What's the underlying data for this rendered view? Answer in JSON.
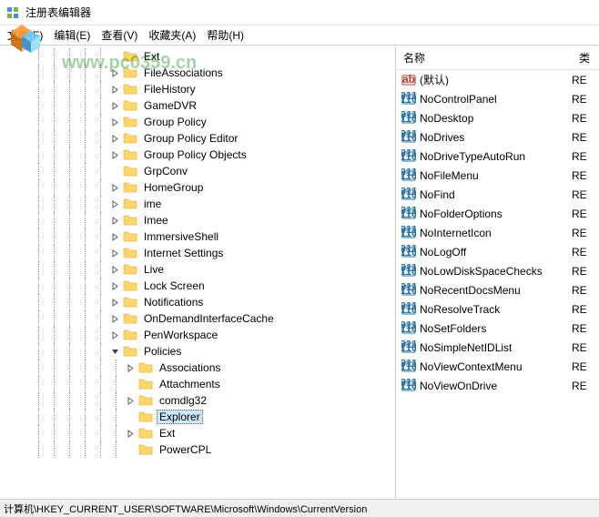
{
  "window": {
    "title": "注册表编辑器"
  },
  "menu": {
    "file": "文件(F)",
    "edit": "编辑(E)",
    "view": "查看(V)",
    "fav": "收藏夹(A)",
    "help": "帮助(H)"
  },
  "watermark": "www.pc0359.cn",
  "list_header": {
    "name": "名称",
    "type": "类"
  },
  "tree": [
    {
      "depth": 7,
      "exp": "",
      "label": "Ext"
    },
    {
      "depth": 7,
      "exp": ">",
      "label": "FileAssociations"
    },
    {
      "depth": 7,
      "exp": ">",
      "label": "FileHistory"
    },
    {
      "depth": 7,
      "exp": ">",
      "label": "GameDVR"
    },
    {
      "depth": 7,
      "exp": ">",
      "label": "Group Policy"
    },
    {
      "depth": 7,
      "exp": ">",
      "label": "Group Policy Editor"
    },
    {
      "depth": 7,
      "exp": ">",
      "label": "Group Policy Objects"
    },
    {
      "depth": 7,
      "exp": "",
      "label": "GrpConv"
    },
    {
      "depth": 7,
      "exp": ">",
      "label": "HomeGroup"
    },
    {
      "depth": 7,
      "exp": ">",
      "label": "ime"
    },
    {
      "depth": 7,
      "exp": ">",
      "label": "Imee"
    },
    {
      "depth": 7,
      "exp": ">",
      "label": "ImmersiveShell"
    },
    {
      "depth": 7,
      "exp": ">",
      "label": "Internet Settings"
    },
    {
      "depth": 7,
      "exp": ">",
      "label": "Live"
    },
    {
      "depth": 7,
      "exp": ">",
      "label": "Lock Screen"
    },
    {
      "depth": 7,
      "exp": ">",
      "label": "Notifications"
    },
    {
      "depth": 7,
      "exp": ">",
      "label": "OnDemandInterfaceCache"
    },
    {
      "depth": 7,
      "exp": ">",
      "label": "PenWorkspace"
    },
    {
      "depth": 7,
      "exp": "v",
      "label": "Policies"
    },
    {
      "depth": 8,
      "exp": ">",
      "label": "Associations"
    },
    {
      "depth": 8,
      "exp": "",
      "label": "Attachments"
    },
    {
      "depth": 8,
      "exp": ">",
      "label": "comdlg32"
    },
    {
      "depth": 8,
      "exp": "",
      "label": "Explorer",
      "selected": true
    },
    {
      "depth": 8,
      "exp": ">",
      "label": "Ext"
    },
    {
      "depth": 8,
      "exp": "",
      "label": "PowerCPL"
    }
  ],
  "values": [
    {
      "icon": "ab",
      "name": "(默认)",
      "type": "RE"
    },
    {
      "icon": "110",
      "name": "NoControlPanel",
      "type": "RE"
    },
    {
      "icon": "110",
      "name": "NoDesktop",
      "type": "RE"
    },
    {
      "icon": "110",
      "name": "NoDrives",
      "type": "RE"
    },
    {
      "icon": "110",
      "name": "NoDriveTypeAutoRun",
      "type": "RE"
    },
    {
      "icon": "110",
      "name": "NoFileMenu",
      "type": "RE"
    },
    {
      "icon": "110",
      "name": "NoFind",
      "type": "RE"
    },
    {
      "icon": "110",
      "name": "NoFolderOptions",
      "type": "RE"
    },
    {
      "icon": "110",
      "name": "NoInternetIcon",
      "type": "RE"
    },
    {
      "icon": "110",
      "name": "NoLogOff",
      "type": "RE"
    },
    {
      "icon": "110",
      "name": "NoLowDiskSpaceChecks",
      "type": "RE"
    },
    {
      "icon": "110",
      "name": "NoRecentDocsMenu",
      "type": "RE"
    },
    {
      "icon": "110",
      "name": "NoResolveTrack",
      "type": "RE"
    },
    {
      "icon": "110",
      "name": "NoSetFolders",
      "type": "RE"
    },
    {
      "icon": "110",
      "name": "NoSimpleNetIDList",
      "type": "RE"
    },
    {
      "icon": "110",
      "name": "NoViewContextMenu",
      "type": "RE"
    },
    {
      "icon": "110",
      "name": "NoViewOnDrive",
      "type": "RE"
    }
  ],
  "status": "计算机\\HKEY_CURRENT_USER\\SOFTWARE\\Microsoft\\Windows\\CurrentVersion"
}
